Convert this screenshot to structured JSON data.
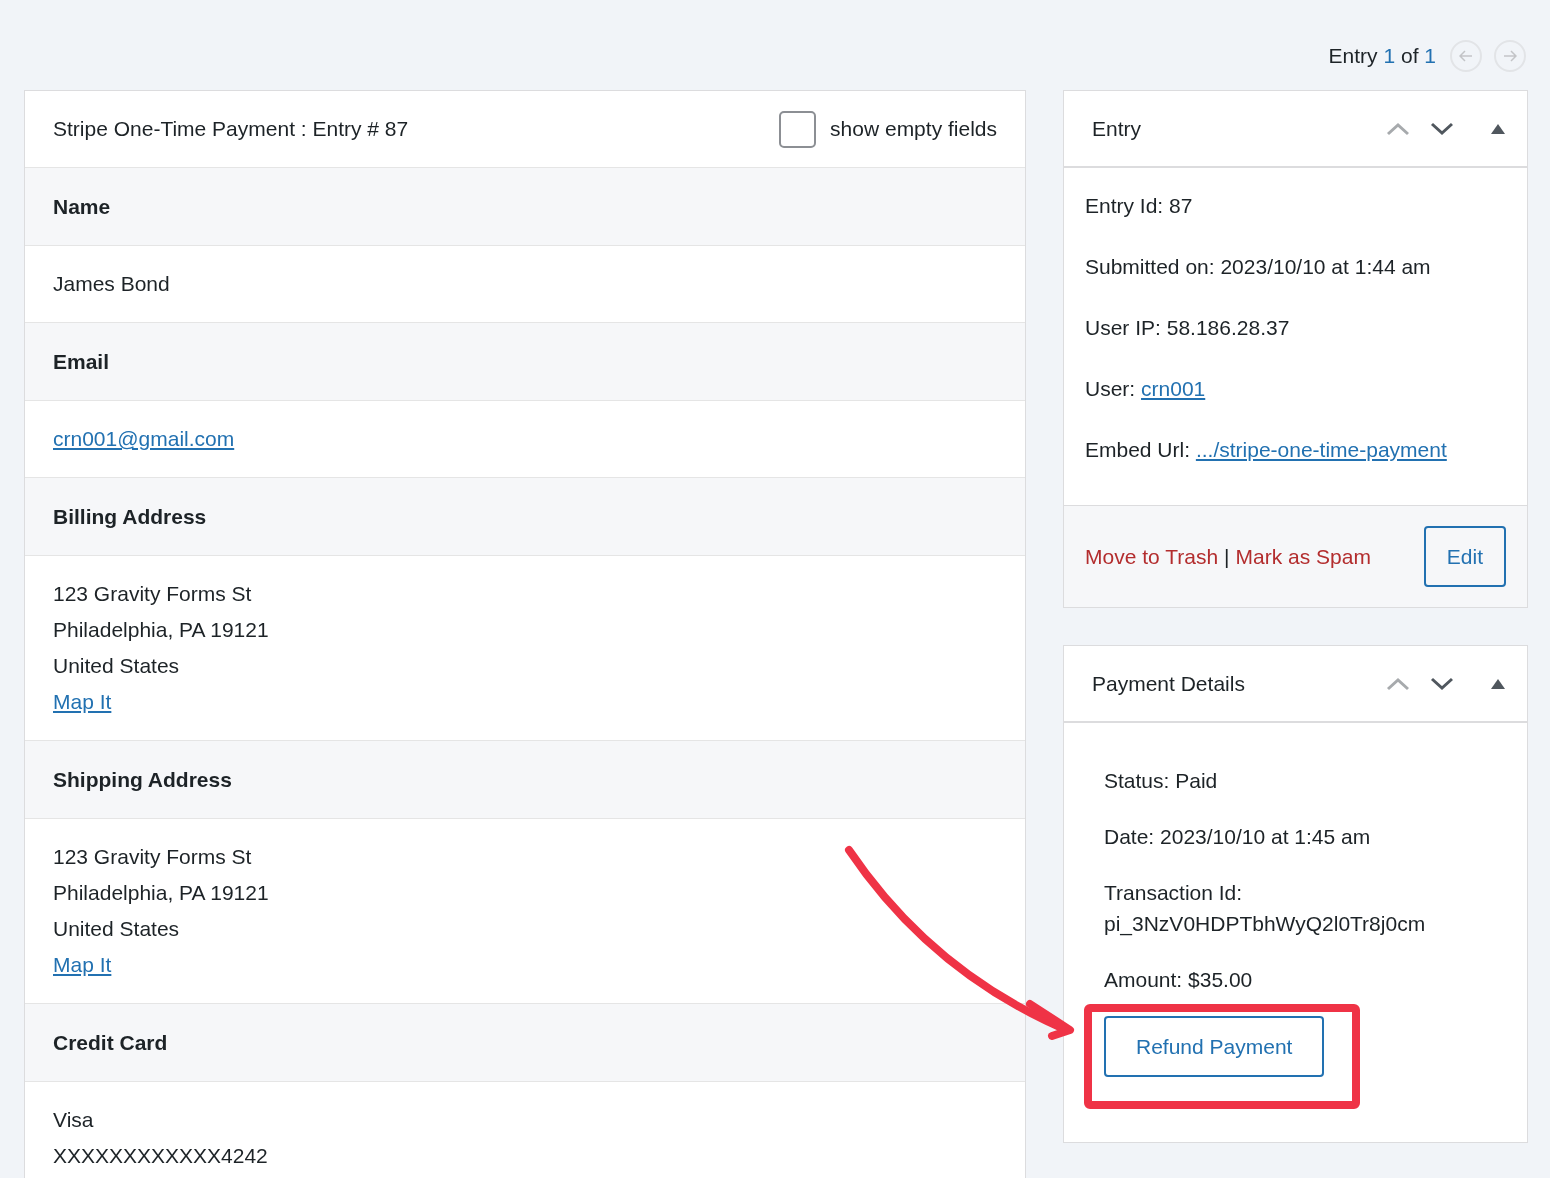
{
  "entry_nav": {
    "word": "Entry",
    "current": "1",
    "of": "of",
    "total": "1",
    "buttons": [
      {
        "kind": "prev",
        "disabled": true
      },
      {
        "kind": "next",
        "disabled": true
      }
    ]
  },
  "entry_panel": {
    "title": "Stripe One-Time Payment : Entry # 87",
    "show_empty": {
      "label": "show empty fields",
      "checked": false
    },
    "fields": [
      {
        "label": "Name",
        "values": [
          {
            "kind": "text",
            "text": "James Bond"
          }
        ]
      },
      {
        "label": "Email",
        "values": [
          {
            "kind": "link",
            "text": "crn001@gmail.com"
          }
        ]
      },
      {
        "label": "Billing Address",
        "values": [
          {
            "kind": "text",
            "text": "123 Gravity Forms St"
          },
          {
            "kind": "text",
            "text": "Philadelphia, PA 19121"
          },
          {
            "kind": "text",
            "text": "United States"
          },
          {
            "kind": "link",
            "text": "Map It"
          }
        ]
      },
      {
        "label": "Shipping Address",
        "values": [
          {
            "kind": "text",
            "text": "123 Gravity Forms St"
          },
          {
            "kind": "text",
            "text": "Philadelphia, PA 19121"
          },
          {
            "kind": "text",
            "text": "United States"
          },
          {
            "kind": "link",
            "text": "Map It"
          }
        ]
      },
      {
        "label": "Credit Card",
        "values": [
          {
            "kind": "text",
            "text": "Visa"
          },
          {
            "kind": "text",
            "text": "XXXXXXXXXXXX4242"
          }
        ]
      }
    ]
  },
  "entry_box": {
    "title": "Entry",
    "controls": [
      {
        "kind": "up",
        "disabled": true
      },
      {
        "kind": "down",
        "disabled": false
      },
      {
        "kind": "toggle",
        "disabled": false
      }
    ],
    "items": [
      {
        "label": "Entry Id:",
        "value": "87"
      },
      {
        "label": "Submitted on:",
        "value": "2023/10/10 at 1:44 am"
      },
      {
        "label": "User IP:",
        "value": "58.186.28.37"
      },
      {
        "label": "User:",
        "link": "crn001"
      },
      {
        "label": "Embed Url:",
        "link": ".../stripe-one-time-payment"
      }
    ],
    "trash": "Move to Trash",
    "separator": "|",
    "spam": "Mark as Spam",
    "edit": "Edit"
  },
  "payment_box": {
    "title": "Payment Details",
    "controls": [
      {
        "kind": "up",
        "disabled": true
      },
      {
        "kind": "down",
        "disabled": false
      },
      {
        "kind": "toggle",
        "disabled": false
      }
    ],
    "items": [
      {
        "label": "Status:",
        "value": "Paid"
      },
      {
        "label": "Date:",
        "value": "2023/10/10 at 1:45 am"
      },
      {
        "label": "Transaction Id:",
        "value": "pi_3NzV0HDPTbhWyQ2l0Tr8j0cm"
      },
      {
        "label": "Amount:",
        "value": "$35.00"
      }
    ],
    "refund": "Refund Payment"
  }
}
